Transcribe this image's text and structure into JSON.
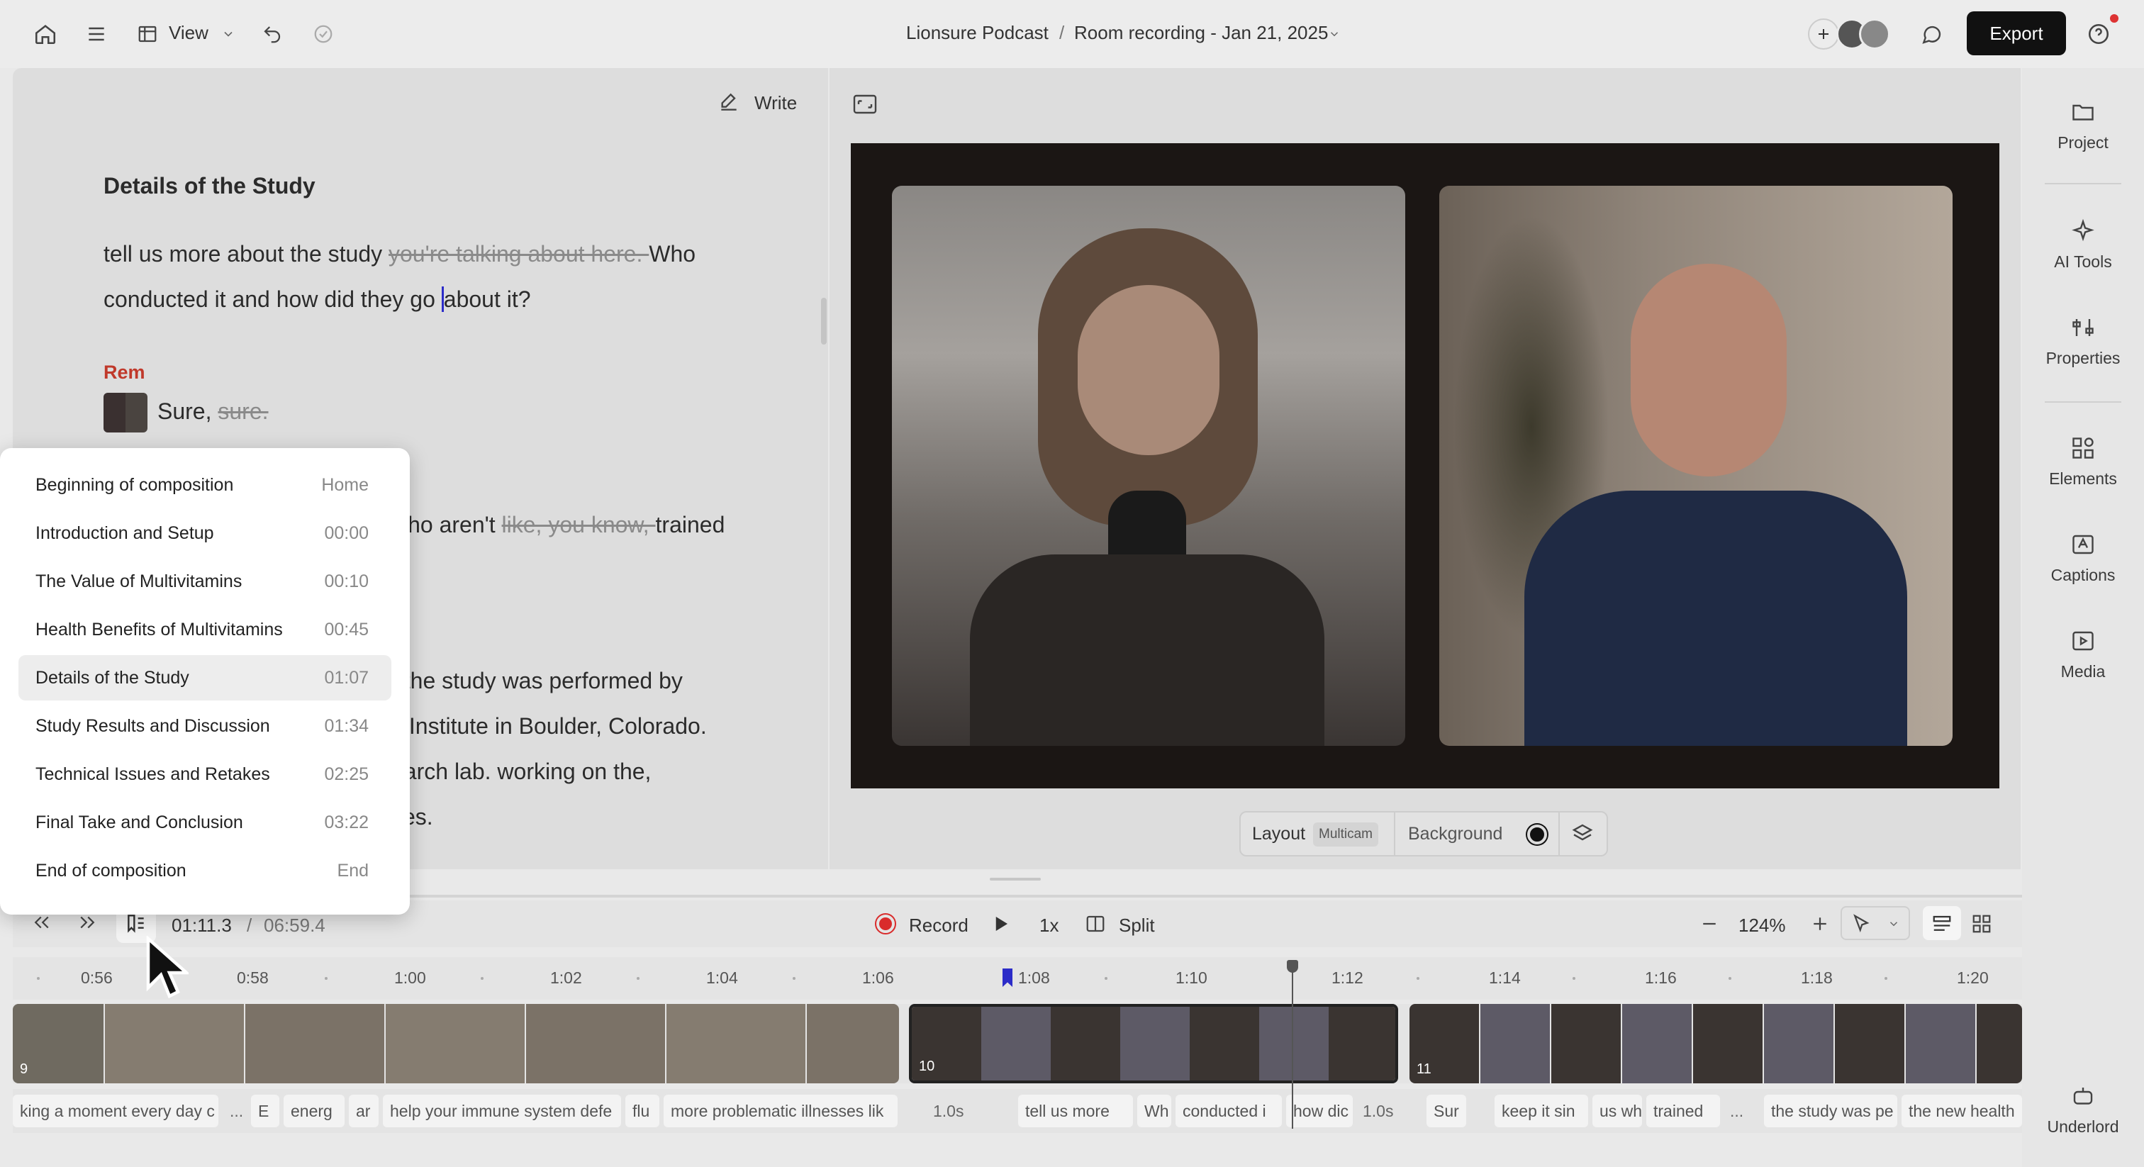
{
  "topbar": {
    "view_label": "View",
    "project_name": "Lionsure Podcast",
    "separator": "/",
    "file_name": "Room recording - Jan 21, 2025",
    "export_label": "Export"
  },
  "rail": {
    "items": [
      {
        "label": "Project",
        "icon": "folder-icon"
      },
      {
        "label": "AI Tools",
        "icon": "sparkle-icon"
      },
      {
        "label": "Properties",
        "icon": "sliders-icon"
      },
      {
        "label": "Elements",
        "icon": "shapes-icon"
      },
      {
        "label": "Captions",
        "icon": "captions-icon"
      },
      {
        "label": "Media",
        "icon": "media-icon"
      }
    ],
    "underlord_label": "Underlord"
  },
  "editor": {
    "write_label": "Write",
    "section_title": "Details of the Study",
    "line1_a": "tell us more about the study ",
    "line1_strike": "you're talking about here. ",
    "line1_b": "Who",
    "line2_a": "conducted it and how did they go ",
    "line2_b": "about it?",
    "speaker": "Rem",
    "speaker_line_a": "Sure, ",
    "speaker_line_strike": "sure.",
    "p3_a": "who aren't ",
    "p3_strike": "like, you know, ",
    "p3_b": "trained",
    "p4_l1": ", the study was performed by",
    "p4_l2": "s Institute in Boulder, Colorado.",
    "p4_l3": "earch lab. working on the,",
    "p4_l4": "ces."
  },
  "layout_bar": {
    "layout_label": "Layout",
    "layout_value": "Multicam",
    "background_label": "Background"
  },
  "chapters": [
    {
      "label": "Beginning of composition",
      "time": "Home"
    },
    {
      "label": "Introduction and Setup",
      "time": "00:00"
    },
    {
      "label": "The Value of Multivitamins",
      "time": "00:10"
    },
    {
      "label": "Health Benefits of Multivitamins",
      "time": "00:45"
    },
    {
      "label": "Details of the Study",
      "time": "01:07"
    },
    {
      "label": "Study Results and Discussion",
      "time": "01:34"
    },
    {
      "label": "Technical Issues and Retakes",
      "time": "02:25"
    },
    {
      "label": "Final Take and Conclusion",
      "time": "03:22"
    },
    {
      "label": "End of composition",
      "time": "End"
    }
  ],
  "transport": {
    "current_time": "01:11.3",
    "separator": "/",
    "total_time": "06:59.4",
    "record_label": "Record",
    "speed_label": "1x",
    "split_label": "Split",
    "zoom_label": "124%"
  },
  "ruler": [
    "0:56",
    "0:58",
    "1:00",
    "1:02",
    "1:04",
    "1:06",
    "1:08",
    "1:10",
    "1:12",
    "1:14",
    "1:16",
    "1:18",
    "1:20"
  ],
  "clips": {
    "clip_a_number": "9",
    "clip_b_number": "10",
    "clip_c_number": "11"
  },
  "words": {
    "w1": "king a moment every day c",
    "g1": "...",
    "w2": "E",
    "w3": "energ",
    "w4": "ar",
    "w5": "help your immune system defe",
    "w6": "flu",
    "w7": "more problematic illnesses lik",
    "g2": "1.0s",
    "w8": "tell us more",
    "w9": "Wh",
    "w10": "conducted i",
    "w11": "how dic",
    "g3": "1.0s",
    "w12": "Sur",
    "w13": "keep it sin",
    "w14": "us wh",
    "w15": "trained",
    "g4": "...",
    "w16": "the study was pe",
    "w17": "the new health"
  },
  "colors": {
    "accent": "#c0392b",
    "record": "#d92b2b",
    "chapter_marker": "#2c2cc8"
  }
}
